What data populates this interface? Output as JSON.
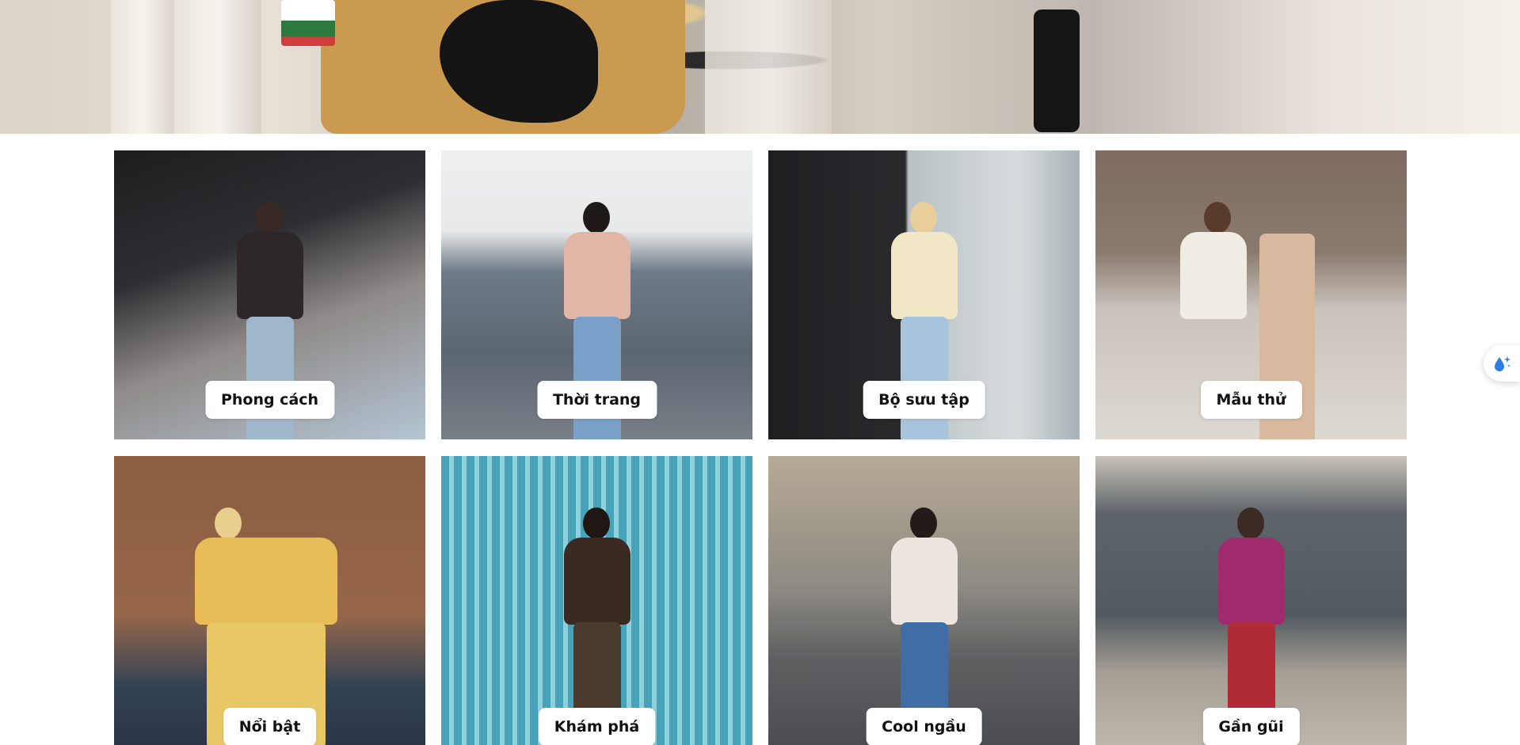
{
  "hero": {
    "icon": "fashion-banner"
  },
  "categories": [
    {
      "label": "Phong cách",
      "theme": "#2a2628"
    },
    {
      "label": "Thời trang",
      "theme": "#6d7b86"
    },
    {
      "label": "Bộ sưu tập",
      "theme": "#2a2a2d"
    },
    {
      "label": "Mẫu thử",
      "theme": "#8a7a6e"
    },
    {
      "label": "Nổi bật",
      "theme": "#8b5e40"
    },
    {
      "label": "Khám phá",
      "theme": "#47a3b8"
    },
    {
      "label": "Cool ngầu",
      "theme": "#8e8b83"
    },
    {
      "label": "Gần gũi",
      "theme": "#5d646a"
    }
  ],
  "side_widget": {
    "icon": "droplet-sparkle-icon"
  }
}
